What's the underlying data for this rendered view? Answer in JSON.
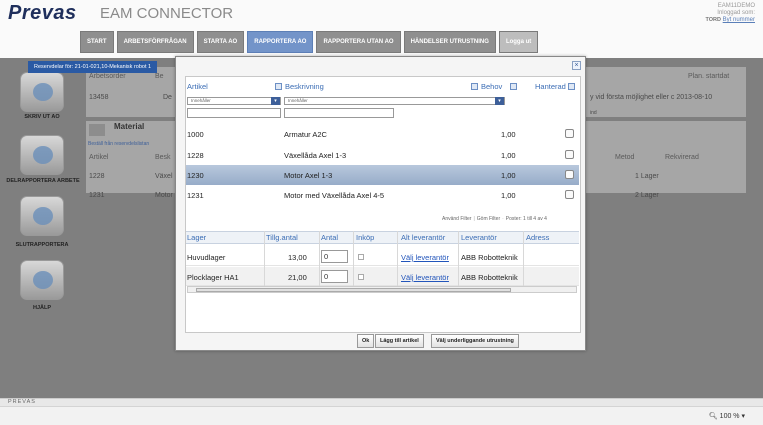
{
  "header": {
    "logo": "Prevas",
    "app_title": "EAM CONNECTOR",
    "user_line1": "EAM11DEMO",
    "user_line2": "Inloggad som:",
    "user_name": "TORD",
    "user_link": "Byt nummer"
  },
  "nav": {
    "items": [
      "START",
      "ARBETSFÖRFRÅGAN",
      "STARTA AO",
      "RAPPORTERA AO",
      "RAPPORTERA UTAN AO",
      "HÄNDELSER UTRUSTNING",
      "Logga ut"
    ],
    "active_index": 3
  },
  "sidebar": {
    "items": [
      "SKRIV UT AO",
      "DELRAPPORTERA ARBETE",
      "SLUTRAPPORTERA",
      "HJÄLP"
    ]
  },
  "background": {
    "hdr_arbetsorder": "Arbetsorder",
    "hdr_be": "Be",
    "order_no": "13458",
    "order_de": "De",
    "hdr_plan": "Plan. startdat",
    "plan_text": "y vid första möjlighet eller c 2013-08-10",
    "material_title": "Material",
    "bestall_link": "Beställ från reservdelslistan",
    "m_hdr_artikel": "Artikel",
    "m_hdr_besk": "Besk",
    "m_hdr_metod": "Metod",
    "m_hdr_rekvirerad": "Rekvirerad",
    "m_rows": [
      {
        "artikel": "1228",
        "besk": "Växel",
        "metod": "1 Lager"
      },
      {
        "artikel": "1231",
        "besk": "Motor",
        "metod": "2 Lager"
      }
    ],
    "bhdr_icons": "",
    "small_hint": "ind"
  },
  "dialog": {
    "tab_title": "Reservdelar för: 21-01-021,10-Mekanisk robot 1",
    "close_glyph": "×",
    "columns": {
      "artikel": "Artikel",
      "beskrivning": "Beskrivning",
      "behov": "Behov",
      "hanterad": "Hanterad"
    },
    "filter_placeholder": "Innehåller",
    "items": [
      {
        "artikel": "1000",
        "beskrivning": "Armatur A2C",
        "behov": "1,00",
        "selected": false
      },
      {
        "artikel": "1228",
        "beskrivning": "Växellåda Axel 1-3",
        "behov": "1,00",
        "selected": false
      },
      {
        "artikel": "1230",
        "beskrivning": "Motor Axel 1-3",
        "behov": "1,00",
        "selected": true
      },
      {
        "artikel": "1231",
        "beskrivning": "Motor med Växellåda Axel 4-5",
        "behov": "1,00",
        "selected": false
      }
    ],
    "paging": {
      "use_filter": "Använd Filter",
      "hide_filter": "Göm Filter",
      "info": "Poster: 1 till 4 av 4"
    },
    "lager_columns": {
      "lager": "Lager",
      "tillg": "Tillg.antal",
      "antal": "Antal",
      "inkop": "Inköp",
      "alt": "Alt leverantör",
      "lev": "Leverantör",
      "adress": "Adress"
    },
    "lager_rows": [
      {
        "lager": "Huvudlager",
        "tillg": "13,00",
        "antal": "0",
        "alt": "Välj leverantör",
        "lev": "ABB Robotteknik"
      },
      {
        "lager": "Plocklager HA1",
        "tillg": "21,00",
        "antal": "0",
        "alt": "Välj leverantör",
        "lev": "ABB Robotteknik"
      }
    ],
    "buttons": {
      "ok": "Ok",
      "add": "Lägg till artikel",
      "choose": "Välj underliggande utrustning"
    }
  },
  "footer": {
    "brand": "PREVAS",
    "zoom": "100 %"
  },
  "colors": {
    "brand": "#1f2f5c",
    "accent": "#7394c9",
    "link": "#2255bb",
    "selected_row": "#a9bbd4"
  },
  "icons": {
    "search": "search-icon",
    "close": "close-icon",
    "zoom": "zoom-icon",
    "dropdown": "chevron-down-icon"
  }
}
